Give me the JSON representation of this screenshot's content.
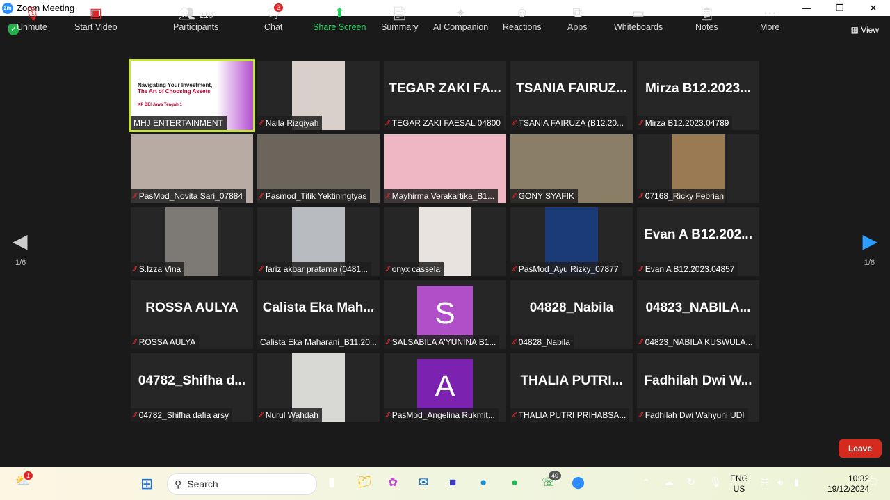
{
  "window": {
    "title": "Zoom Meeting",
    "logo": "zm"
  },
  "view_label": "View",
  "pager": {
    "left": "1/6",
    "right": "1/6"
  },
  "tiles": [
    {
      "kind": "share",
      "label": "MHJ ENTERTAINMENT",
      "slide_title": "Navigating Your Investment,",
      "slide_subtitle": "The Art of Choosing Assets",
      "slide_org": "KP BEI Jawa Tengah 1",
      "muted": false
    },
    {
      "kind": "video",
      "label": "Naila Rizqiyah",
      "muted": true,
      "color": "#d9d0cb"
    },
    {
      "kind": "name",
      "big": "TEGAR ZAKI FA...",
      "label": "TEGAR ZAKI FAESAL 04800",
      "muted": true
    },
    {
      "kind": "name",
      "big": "TSANIA FAIRUZ...",
      "label": "TSANIA FAIRUZA (B12.20...",
      "muted": true
    },
    {
      "kind": "name",
      "big": "Mirza B12.2023...",
      "label": "Mirza B12.2023.04789",
      "muted": true
    },
    {
      "kind": "video",
      "label": "PasMod_Novita Sari_07884",
      "muted": true,
      "color": "#b8aba3",
      "full": true
    },
    {
      "kind": "video",
      "label": "Pasmod_Titik Yektiningtyas",
      "muted": true,
      "color": "#6c655c",
      "full": true
    },
    {
      "kind": "video",
      "label": "Mayhirma Verakartika_B1...",
      "muted": true,
      "color": "#efb7c4",
      "full": true
    },
    {
      "kind": "video",
      "label": "GONY SYAFIK",
      "muted": true,
      "color": "#8b7e66",
      "full": true
    },
    {
      "kind": "video",
      "label": "07168_Ricky Febrian",
      "muted": true,
      "color": "#9a7a52"
    },
    {
      "kind": "video",
      "label": "S.Izza Vina",
      "muted": true,
      "color": "#7d7a75"
    },
    {
      "kind": "video",
      "label": "fariz akbar pratama (0481...",
      "muted": true,
      "color": "#b8bcc0"
    },
    {
      "kind": "video",
      "label": "onyx cassela",
      "muted": true,
      "color": "#e9e3df"
    },
    {
      "kind": "video",
      "label": "PasMod_Ayu Rizky_07877",
      "muted": true,
      "color": "#1b3a78"
    },
    {
      "kind": "name",
      "big": "Evan A B12.202...",
      "label": "Evan A B12.2023.04857",
      "muted": true
    },
    {
      "kind": "name",
      "big": "ROSSA AULYA",
      "label": "ROSSA AULYA",
      "muted": true
    },
    {
      "kind": "name",
      "big": "Calista Eka Mah...",
      "label": "Calista Eka Maharani_B11.20...",
      "muted": false
    },
    {
      "kind": "avatar",
      "letter": "S",
      "color": "#b04fc7",
      "label": "SALSABILA A'YUNINA B1...",
      "muted": true
    },
    {
      "kind": "name",
      "big": "04828_Nabila",
      "label": "04828_Nabila",
      "muted": true
    },
    {
      "kind": "name",
      "big": "04823_NABILA...",
      "label": "04823_NABILA KUSWULA...",
      "muted": true
    },
    {
      "kind": "name",
      "big": "04782_Shifha d...",
      "label": "04782_Shifha dafia arsy",
      "muted": true
    },
    {
      "kind": "video",
      "label": "Nurul Wahdah",
      "muted": true,
      "color": "#d8d8d4"
    },
    {
      "kind": "avatar",
      "letter": "A",
      "color": "#7b22b0",
      "label": "PasMod_Angelina Rukmit...",
      "muted": true
    },
    {
      "kind": "name",
      "big": "THALIA PUTRI...",
      "label": "THALIA PUTRI PRIHABSA...",
      "muted": true
    },
    {
      "kind": "name",
      "big": "Fadhilah Dwi W...",
      "label": "Fadhilah Dwi Wahyuni UDI",
      "muted": true
    }
  ],
  "toolbar": {
    "unmute": "Unmute",
    "start_video": "Start Video",
    "participants": "Participants",
    "participants_count": "210",
    "chat": "Chat",
    "chat_badge": "3",
    "share": "Share Screen",
    "summary": "Summary",
    "ai": "AI Companion",
    "reactions": "Reactions",
    "apps": "Apps",
    "whiteboards": "Whiteboards",
    "notes": "Notes",
    "more": "More",
    "leave": "Leave"
  },
  "taskbar": {
    "search": "Search",
    "weather_badge": "1",
    "whatsapp_badge": "40",
    "lang1": "ENG",
    "lang2": "US",
    "time": "10:32",
    "date": "19/12/2024"
  }
}
